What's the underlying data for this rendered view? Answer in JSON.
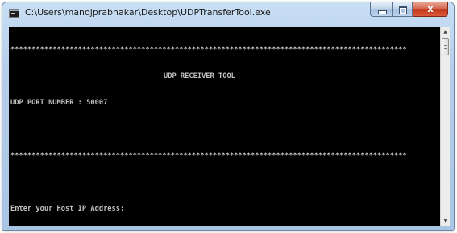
{
  "window": {
    "title": "C:\\Users\\manojprabhakar\\Desktop\\UDPTransferTool.exe"
  },
  "caption_buttons": {
    "minimize_icon": "minimize-icon",
    "maximize_icon": "maximize-icon",
    "close_icon": "close-icon",
    "close_glyph": "x"
  },
  "console": {
    "lines": [
      "**********************************************************************************************",
      "UDP RECEIVER TOOL",
      "UDP PORT NUMBER : 50007",
      "",
      "**********************************************************************************************",
      "",
      "Enter your Host IP Address:"
    ]
  },
  "scrollbar": {
    "up_arrow": "▲",
    "down_arrow": "▼"
  },
  "colors": {
    "console_background": "#000000",
    "console_text": "#c0c0c0",
    "close_button": "#c2371a",
    "titlebar": "#b4cde9"
  }
}
